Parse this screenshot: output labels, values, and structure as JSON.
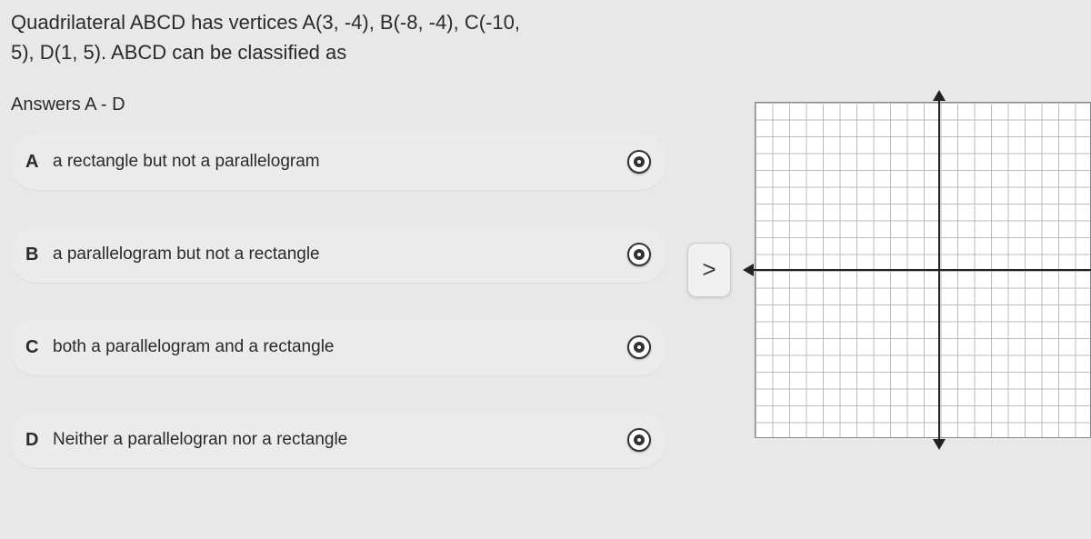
{
  "question": {
    "line1": "Quadrilateral ABCD has vertices A(3, -4), B(-8, -4), C(-10,",
    "line2": "5), D(1, 5).  ABCD can be classified as"
  },
  "answers_header": "Answers A - D",
  "options": [
    {
      "letter": "A",
      "text": "a rectangle but not a parallelogram"
    },
    {
      "letter": "B",
      "text": "a parallelogram but not a rectangle"
    },
    {
      "letter": "C",
      "text": "both a parallelogram and a rectangle"
    },
    {
      "letter": "D",
      "text": "Neither a parallelogran nor a rectangle"
    }
  ],
  "nav": {
    "next_symbol": ">"
  }
}
